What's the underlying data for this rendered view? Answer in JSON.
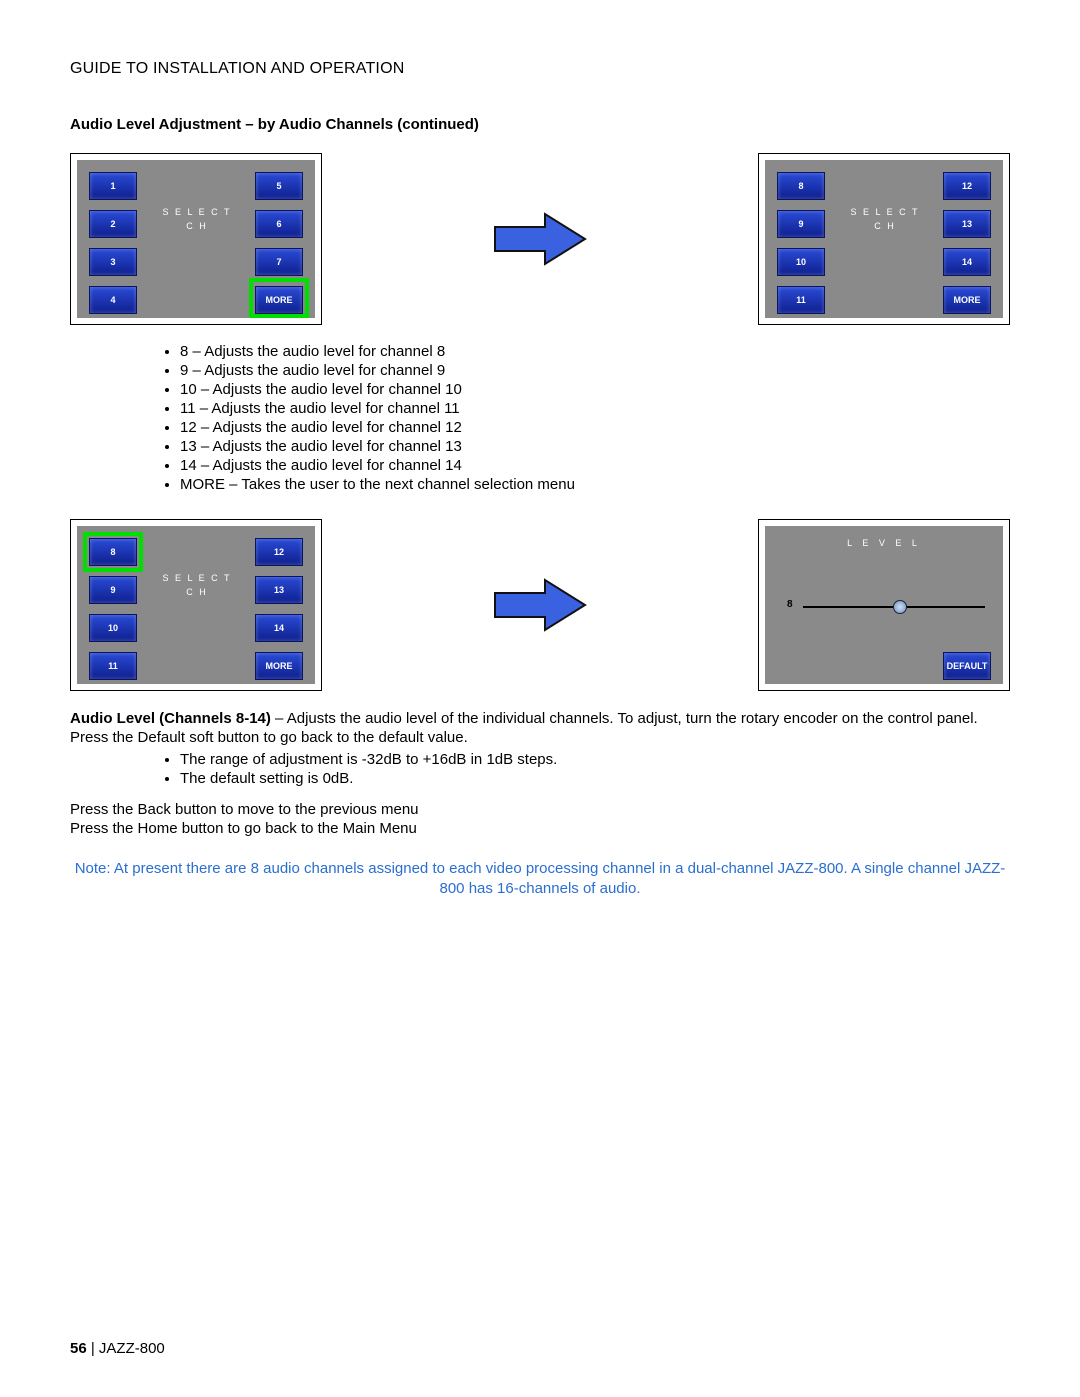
{
  "header": "GUIDE TO INSTALLATION AND OPERATION",
  "sectionTitle": "Audio Level Adjustment – by Audio Channels (continued)",
  "panel1": {
    "center1": "S E L E C T",
    "center2": "C H",
    "left": [
      "1",
      "2",
      "3",
      "4"
    ],
    "right": [
      "5",
      "6",
      "7",
      "MORE"
    ]
  },
  "panel2": {
    "center1": "S E L E C T",
    "center2": "C H",
    "left": [
      "8",
      "9",
      "10",
      "11"
    ],
    "right": [
      "12",
      "13",
      "14",
      "MORE"
    ]
  },
  "bullets1": [
    "8 – Adjusts the audio level for channel 8",
    "9 – Adjusts the audio level for channel 9",
    "10 – Adjusts the audio level for channel 10",
    "11 – Adjusts the audio level for channel 11",
    "12 – Adjusts the audio level for channel 12",
    "13 – Adjusts the audio level for channel 13",
    "14 – Adjusts the audio level for channel 14",
    "MORE – Takes the user to the next channel selection menu"
  ],
  "panel3": {
    "center1": "S E L E C T",
    "center2": "C H",
    "left": [
      "8",
      "9",
      "10",
      "11"
    ],
    "right": [
      "12",
      "13",
      "14",
      "MORE"
    ]
  },
  "level": {
    "title": "L E V E L",
    "channel": "8",
    "default": "DEFAULT"
  },
  "para1Bold": "Audio Level (Channels 8-14)",
  "para1Rest": " – Adjusts the audio level of the individual channels. To adjust, turn the rotary encoder on the control panel. Press the Default soft button to go back to the default value.",
  "bullets2": [
    "The range of adjustment is -32dB to +16dB in 1dB steps.",
    "The default setting is 0dB."
  ],
  "para2": "Press the Back button to move to the previous menu",
  "para3": "Press the Home button to go back to the Main Menu",
  "note": "Note: At present there are 8 audio channels assigned to each video processing channel in a dual-channel JAZZ-800. A single channel JAZZ-800 has 16-channels of audio.",
  "footer": {
    "page": "56",
    "sep": "  |  ",
    "product": "JAZZ-800"
  }
}
